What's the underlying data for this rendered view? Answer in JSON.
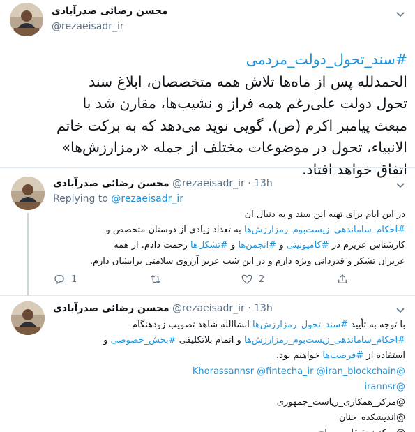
{
  "main_tweet": {
    "author_name": "محسن رضائی صدرآبادی",
    "handle": "@rezaeisadr_ir",
    "hashtag": "#سند_تحول_دولت_مردمی",
    "lines": [
      "الحمدلله پس از ماه‌ها تلاش همه متخصصان، ابلاغ سند",
      "تحول دولت علی‌رغم همه فراز و نشیب‌ها، مقارن شد با",
      "مبعث پیامبر اکرم (ص). گویی نوید می‌دهد که به برکت خاتم",
      "الانبیاء، تحول در موضوعات مختلف از جمله «رمزارزش‌ها»",
      "اتفاق خواهد افتاد."
    ]
  },
  "reply1": {
    "author_name": "محسن رضائی صدرآبادی",
    "handle": "@rezaeisadr_ir",
    "separator": "·",
    "time": "13h",
    "replying_label": "Replying to",
    "replying_handle": "@rezaeisadr_ir",
    "lines": [
      "در این ایام برای تهیه این سند و به دنبال آن",
      "#احکام_ساماندهی_زیست‌بوم_رمزارزش‌ها به تعداد زیادی از دوستان متخصص و",
      "کارشناس عزیزم در #کامیونیتی و #انجمن‌ها و #تشکل‌ها زحمت دادم. از همه",
      "عزیزان تشکر و قدردانی ویژه دارم و در این شب عزیز آرزوی سلامتی برایشان دارم."
    ],
    "reply_count": "1",
    "retweet_count": "",
    "like_count": "2"
  },
  "reply2": {
    "author_name": "محسن رضائی صدرآبادی",
    "handle": "@rezaeisadr_ir",
    "separator": "·",
    "time": "13h",
    "lines": [
      "با توجه به تأیید #سند_تحول_رمزارزش‌ها انشاالله شاهد تصویب زودهنگام",
      "#احکام_ساماندهی_زیست‌بوم_رمزارزش‌ها و اتمام بلاتکلیفی #بخش_خصوصی و",
      "استفاده از #فرصت‌ها خواهیم بود.",
      "@Khorassannsr @fintecha_ir @iran_blockchain",
      "@irannsr",
      "@مرکز_همکاری_ریاست_جمهوری",
      "@اندیشکده_حنان",
      "@مرکز تحقیقات سراج"
    ]
  },
  "icons": {
    "caret": "chevron-down-icon",
    "reply": "reply-icon",
    "retweet": "retweet-icon",
    "like": "heart-icon",
    "share": "share-icon"
  },
  "colors": {
    "link": "#1b95e0",
    "muted": "#5b7083",
    "divider": "#e1e8ed"
  }
}
